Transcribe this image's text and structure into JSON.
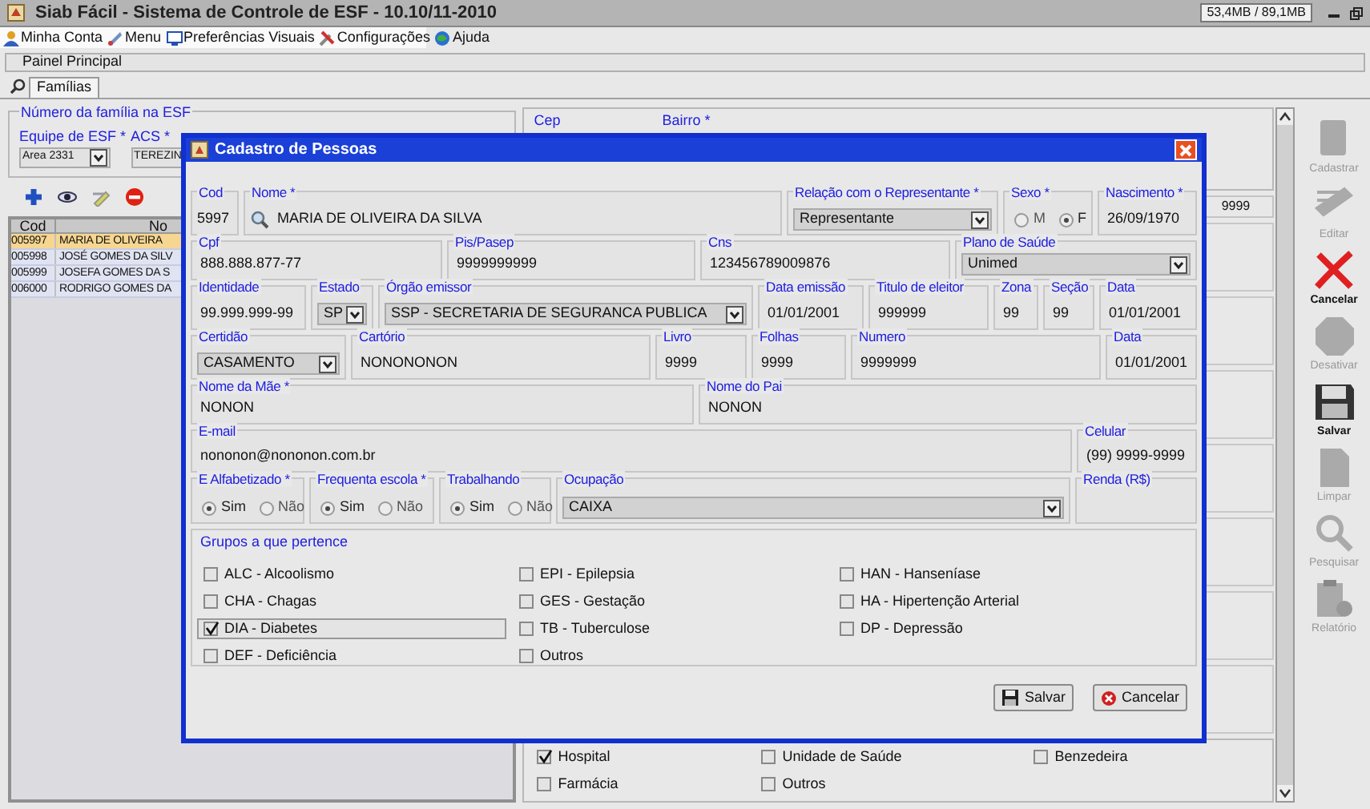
{
  "window": {
    "title": "Siab Fácil - Sistema de Controle de ESF - 10.10/11-2010",
    "memory": "53,4MB / 89,1MB"
  },
  "menu": [
    {
      "label": "Minha Conta",
      "kind": "account"
    },
    {
      "label": "Menu",
      "kind": "menu"
    },
    {
      "label": "Preferências Visuais",
      "kind": "display"
    },
    {
      "label": "Configurações",
      "kind": "tools"
    },
    {
      "label": "Ajuda",
      "kind": "help"
    }
  ],
  "panel_title": "Painel Principal",
  "tabs": [
    {
      "label": "Famílias",
      "selected": true
    }
  ],
  "family_form": {
    "group_label": "Número da família na ESF",
    "fields": [
      {
        "label": "Equipe de ESF *",
        "value": "Area 2331"
      },
      {
        "label": "ACS *",
        "value": "TEREZIN"
      }
    ]
  },
  "family_actions": [
    {
      "kind": "add"
    },
    {
      "kind": "view"
    },
    {
      "kind": "edit"
    },
    {
      "kind": "delete"
    }
  ],
  "family_table": {
    "columns": [
      "Cod",
      "No"
    ],
    "rows": [
      {
        "cells": [
          "005997",
          "MARIA DE OLIVEIRA"
        ],
        "selected": true
      },
      {
        "cells": [
          "005998",
          "JOSÉ GOMES DA SILV"
        ],
        "selected": false
      },
      {
        "cells": [
          "005999",
          "JOSEFA GOMES DA S"
        ],
        "selected": false
      },
      {
        "cells": [
          "006000",
          "RODRIGO GOMES DA"
        ],
        "selected": false
      }
    ]
  },
  "address": {
    "fields": [
      "Cep",
      "Bairro *"
    ],
    "fragment": "9999"
  },
  "places": [
    {
      "label": "Hospital",
      "checked": true
    },
    {
      "label": "Unidade de Saúde",
      "checked": false
    },
    {
      "label": "Benzedeira",
      "checked": false
    },
    {
      "label": "Farmácia",
      "checked": false
    },
    {
      "label": "Outros",
      "checked": false
    }
  ],
  "toolbar": [
    {
      "label": "Cadastrar",
      "kind": "add",
      "disabled": true
    },
    {
      "label": "Editar",
      "kind": "edit",
      "disabled": true
    },
    {
      "label": "Cancelar",
      "kind": "cancel",
      "disabled": false
    },
    {
      "label": "Desativar",
      "kind": "deactivate",
      "disabled": true
    },
    {
      "label": "Salvar",
      "kind": "save",
      "disabled": false
    },
    {
      "label": "Limpar",
      "kind": "clear",
      "disabled": true
    },
    {
      "label": "Pesquisar",
      "kind": "search",
      "disabled": true
    },
    {
      "label": "Relatório",
      "kind": "report",
      "disabled": true
    }
  ],
  "dialog": {
    "title": "Cadastro de Pessoas",
    "rows": [
      {
        "fields": [
          {
            "label": "Cod",
            "kind": "number",
            "value": "5997"
          },
          {
            "label": "Nome *",
            "kind": "search",
            "value": "MARIA DE OLIVEIRA DA SILVA"
          },
          {
            "label": "Relação com o Representante *",
            "kind": "select",
            "value": "Representante"
          },
          {
            "label": "Sexo *",
            "kind": "radio",
            "options": [
              {
                "label": "M",
                "selected": false
              },
              {
                "label": "F",
                "selected": true
              }
            ]
          },
          {
            "label": "Nascimento *",
            "kind": "text",
            "value": "26/09/1970"
          }
        ]
      },
      {
        "fields": [
          {
            "label": "Cpf",
            "kind": "text",
            "value": "888.888.877-77"
          },
          {
            "label": "Pis/Pasep",
            "kind": "text",
            "value": "9999999999"
          },
          {
            "label": "Cns",
            "kind": "text",
            "value": "123456789009876"
          },
          {
            "label": "Plano de Saúde",
            "kind": "select",
            "value": "Unimed"
          }
        ]
      },
      {
        "fields": [
          {
            "label": "Identidade",
            "kind": "text",
            "value": "99.999.999-99"
          },
          {
            "label": "Estado",
            "kind": "select",
            "value": "SP"
          },
          {
            "label": "Órgão emissor",
            "kind": "select",
            "value": "SSP - SECRETARIA DE SEGURANCA PUBLICA"
          },
          {
            "label": "Data emissão",
            "kind": "text",
            "value": "01/01/2001"
          },
          {
            "label": "Titulo de eleitor",
            "kind": "text",
            "value": "999999"
          },
          {
            "label": "Zona",
            "kind": "text",
            "value": "99"
          },
          {
            "label": "Seção",
            "kind": "text",
            "value": "99"
          },
          {
            "label": "Data",
            "kind": "text",
            "value": "01/01/2001"
          }
        ]
      },
      {
        "fields": [
          {
            "label": "Certidão",
            "kind": "select",
            "value": "CASAMENTO"
          },
          {
            "label": "Cartório",
            "kind": "text",
            "value": "NONONONON"
          },
          {
            "label": "Livro",
            "kind": "text",
            "value": "9999"
          },
          {
            "label": "Folhas",
            "kind": "text",
            "value": "9999"
          },
          {
            "label": "Numero",
            "kind": "text",
            "value": "9999999"
          },
          {
            "label": "Data",
            "kind": "text",
            "value": "01/01/2001"
          }
        ]
      },
      {
        "fields": [
          {
            "label": "Nome da Mãe *",
            "kind": "text",
            "value": "NONON"
          },
          {
            "label": "Nome do Pai",
            "kind": "text",
            "value": "NONON"
          }
        ]
      },
      {
        "fields": [
          {
            "label": "E-mail",
            "kind": "text",
            "value": "nononon@nononon.com.br"
          },
          {
            "label": "Celular",
            "kind": "text",
            "value": "(99) 9999-9999"
          }
        ]
      },
      {
        "fields": [
          {
            "label": "E Alfabetizado *",
            "kind": "radio",
            "options": [
              {
                "label": "Sim",
                "selected": true
              },
              {
                "label": "Não",
                "selected": false
              }
            ]
          },
          {
            "label": "Frequenta escola *",
            "kind": "radio",
            "options": [
              {
                "label": "Sim",
                "selected": true
              },
              {
                "label": "Não",
                "selected": false
              }
            ]
          },
          {
            "label": "Trabalhando",
            "kind": "radio",
            "options": [
              {
                "label": "Sim",
                "selected": true
              },
              {
                "label": "Não",
                "selected": false
              }
            ]
          },
          {
            "label": "Ocupação",
            "kind": "select",
            "value": "CAIXA"
          },
          {
            "label": "Renda (R$)",
            "kind": "text"
          }
        ]
      }
    ],
    "groups": {
      "label": "Grupos a que pertence",
      "items": [
        {
          "label": "ALC - Alcoolismo",
          "checked": false,
          "focused": false
        },
        {
          "label": "EPI - Epilepsia",
          "checked": false,
          "focused": false
        },
        {
          "label": "HAN - Hanseníase",
          "checked": false,
          "focused": false
        },
        {
          "label": "CHA - Chagas",
          "checked": false,
          "focused": false
        },
        {
          "label": "GES - Gestação",
          "checked": false,
          "focused": false
        },
        {
          "label": "HA - Hipertenção Arterial",
          "checked": false,
          "focused": false
        },
        {
          "label": "DIA - Diabetes",
          "checked": true,
          "focused": true
        },
        {
          "label": "TB - Tuberculose",
          "checked": false,
          "focused": false
        },
        {
          "label": "DP - Depressão",
          "checked": false,
          "focused": false
        },
        {
          "label": "DEF - Deficiência",
          "checked": false,
          "focused": false
        },
        {
          "label": "Outros",
          "checked": false,
          "focused": false
        }
      ]
    },
    "buttons": [
      {
        "label": "Salvar",
        "kind": "save"
      },
      {
        "label": "Cancelar",
        "kind": "cancel"
      }
    ]
  }
}
